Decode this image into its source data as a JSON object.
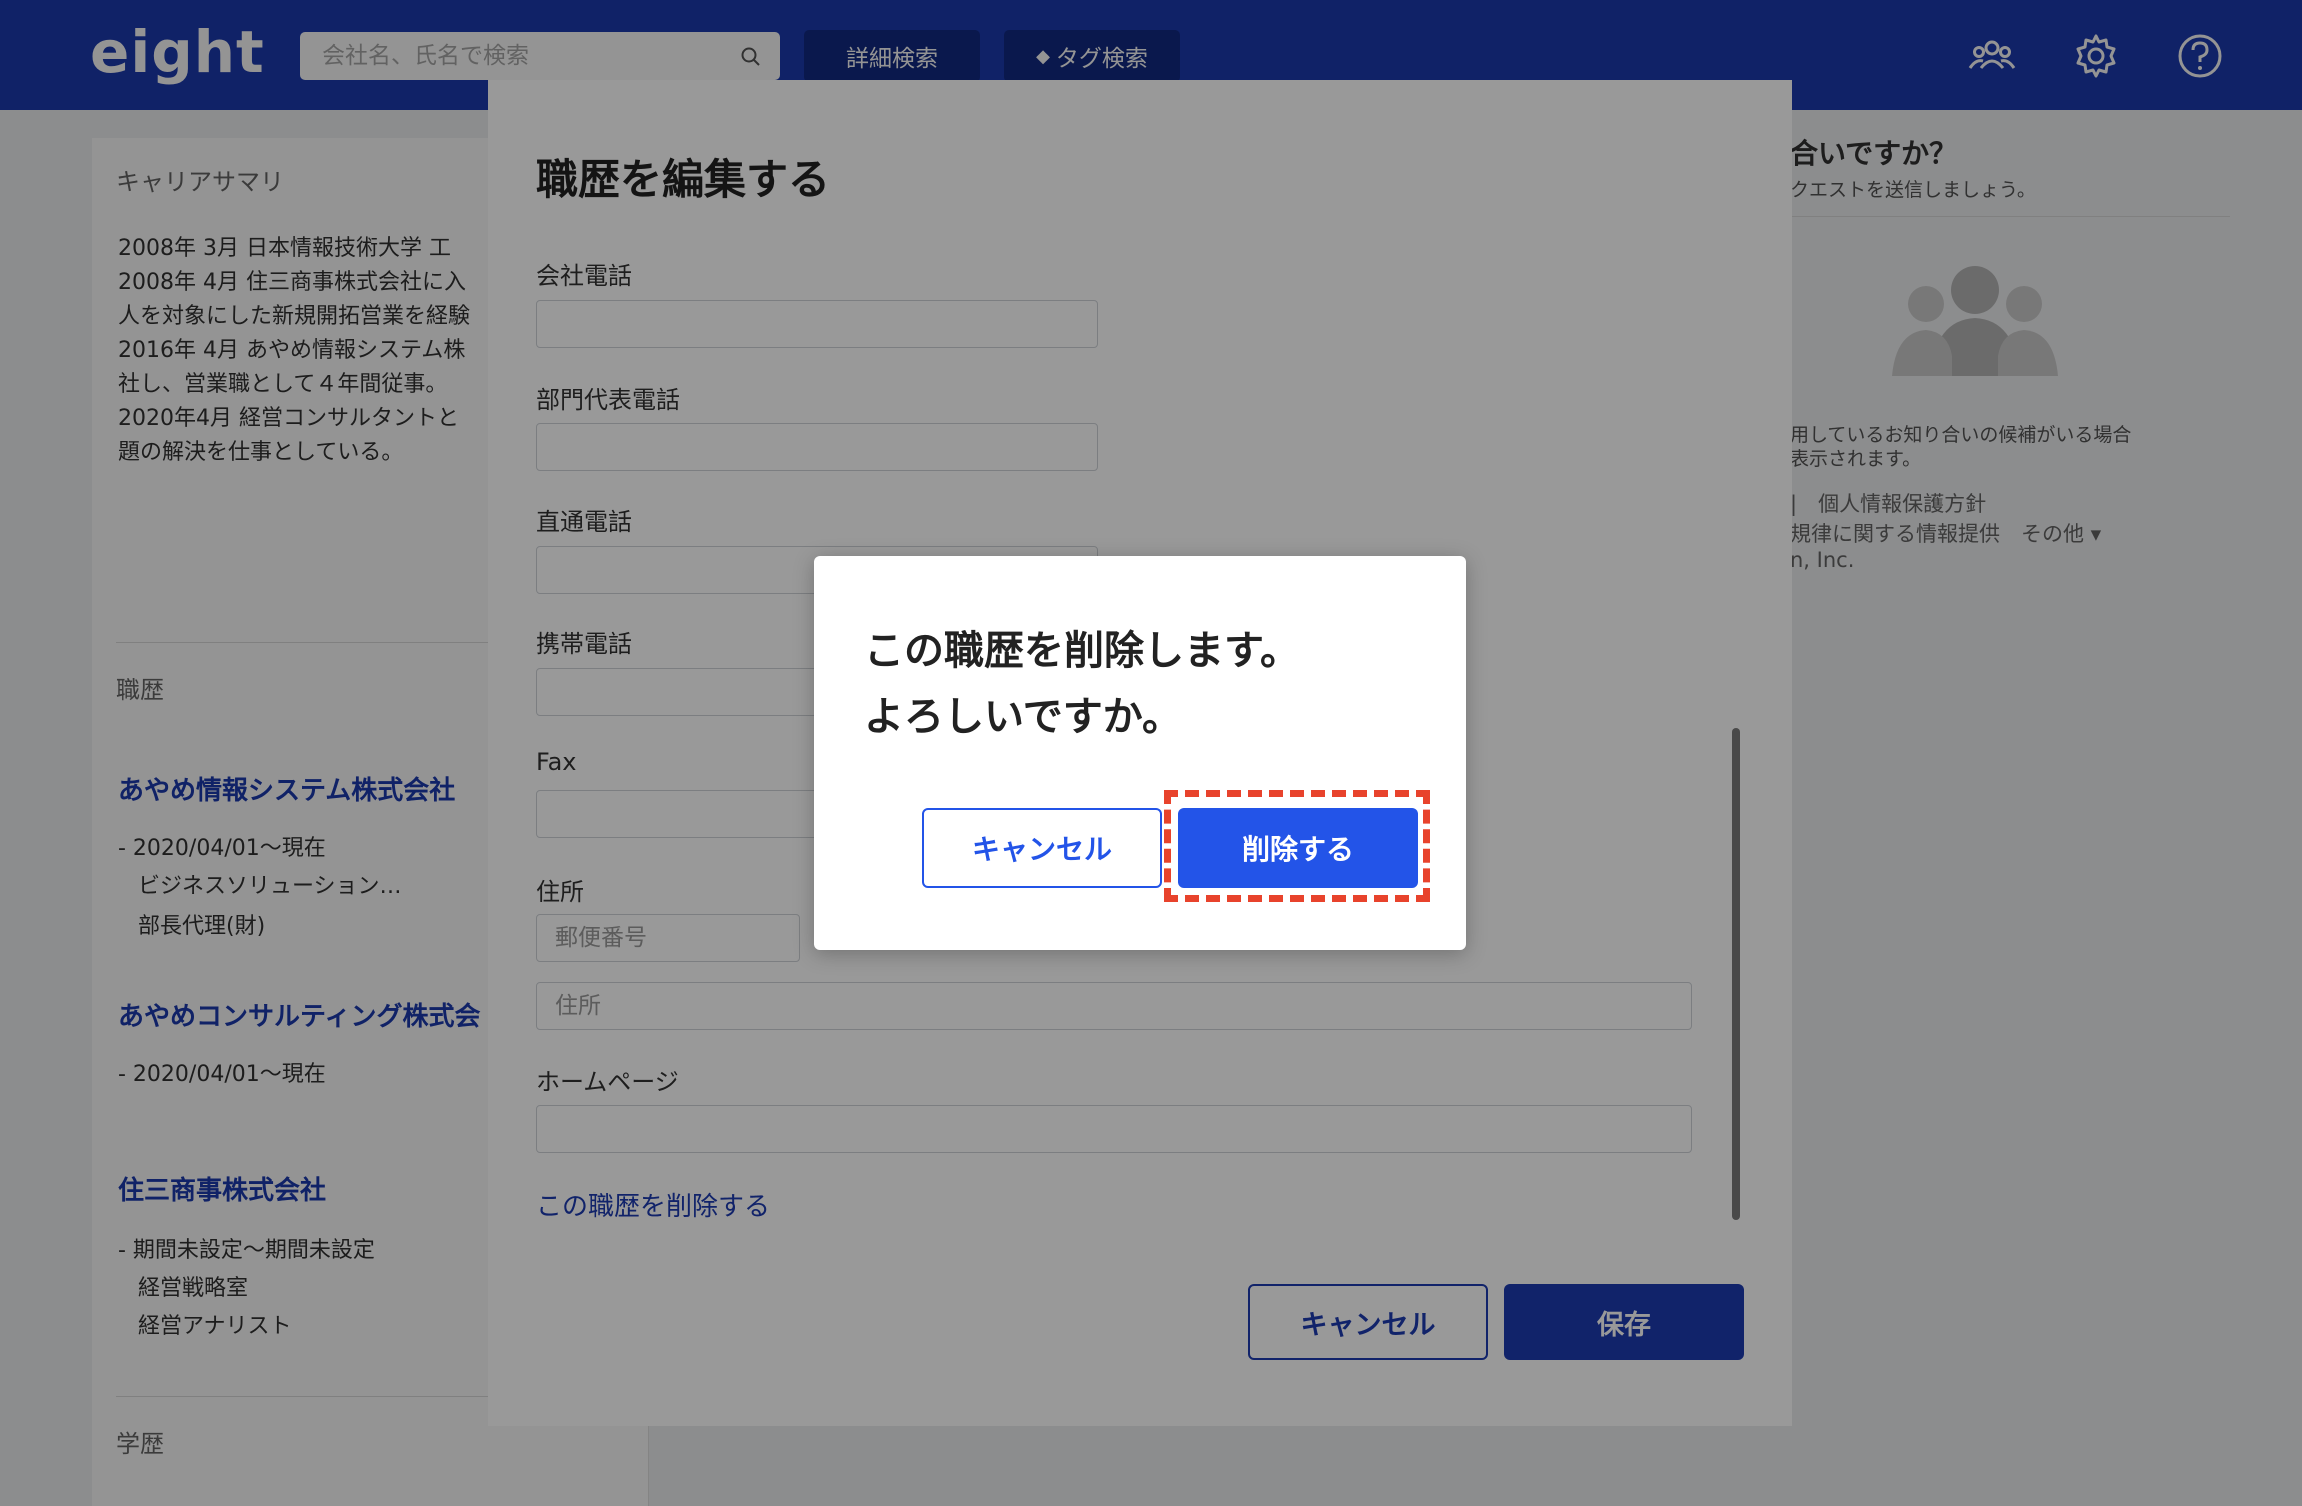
{
  "header": {
    "logo": "eight",
    "search_placeholder": "会社名、氏名で検索",
    "detail_search": "詳細検索",
    "tag_search": "タグ検索",
    "icons": [
      "people-icon",
      "gear-icon",
      "help-icon"
    ]
  },
  "background": {
    "career_summary_label": "キャリアサマリ",
    "summary_lines": [
      "2008年 3月 日本情報技術大学 工",
      "2008年 4月 住三商事株式会社に入",
      "人を対象にした新規開拓営業を経験",
      "2016年 4月 あやめ情報システム株",
      "社し、営業職として４年間従事。",
      "2020年4月 経営コンサルタントと",
      "題の解決を仕事としている。"
    ],
    "career_label": "職歴",
    "companies": [
      {
        "name": "あやめ情報システム株式会社",
        "lines": [
          "- 2020/04/01〜現在",
          "ビジネスソリューション…",
          "部長代理(財)"
        ]
      },
      {
        "name": "あやめコンサルティング株式会",
        "lines": [
          "- 2020/04/01〜現在"
        ]
      },
      {
        "name": "住三商事株式会社",
        "lines": [
          "- 期間未設定〜期間未設定",
          "経営戦略室",
          "経営アナリスト"
        ]
      }
    ],
    "education_label": "学歴",
    "right_title": "合いですか？",
    "right_sub": "クエストを送信しましょう。",
    "right_note_1": "用しているお知り合いの候補がいる場合",
    "right_note_2": "表示されます。",
    "right_links_1": "|　個人情報保護方針",
    "right_links_2": "規律に関する情報提供　その他 ▾",
    "right_links_3": "n, Inc."
  },
  "edit_modal": {
    "title": "職歴を編集する",
    "fields": {
      "company_phone_label": "会社電話",
      "dept_phone_label": "部門代表電話",
      "direct_phone_label": "直通電話",
      "mobile_label": "携帯電話",
      "fax_label": "Fax",
      "address_label": "住所",
      "zip_placeholder": "郵便番号",
      "address_placeholder": "住所",
      "homepage_label": "ホームページ"
    },
    "delete_link": "この職歴を削除する",
    "cancel": "キャンセル",
    "save": "保存"
  },
  "confirm_dialog": {
    "message_line1": "この職歴を削除します。",
    "message_line2": "よろしいですか。",
    "cancel": "キャンセル",
    "delete": "削除する"
  },
  "colors": {
    "brand": "#1d3bb1",
    "confirm_accent": "#2354e8",
    "highlight": "#e8432c"
  }
}
